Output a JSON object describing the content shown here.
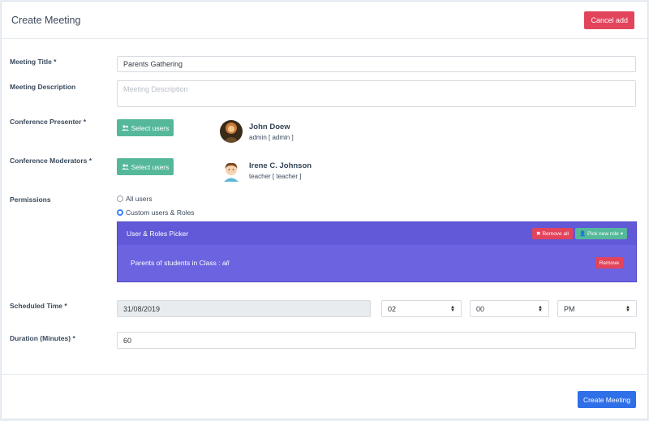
{
  "header": {
    "title": "Create Meeting",
    "cancel_label": "Cancel add"
  },
  "fields": {
    "title_label": "Meeting Title *",
    "title_value": "Parents Gathering",
    "description_label": "Meeting Description",
    "description_placeholder": "Meeting Description",
    "presenter_label": "Conference Presenter *",
    "moderators_label": "Conference Moderators *",
    "select_users_label": "Select users",
    "permissions_label": "Permissions",
    "scheduled_label": "Scheduled Time *",
    "duration_label": "Duration (Minutes) *",
    "duration_value": "60"
  },
  "presenter": {
    "name": "John Doew",
    "role": "admin [ admin ]"
  },
  "moderator": {
    "name": "Irene C. Johnson",
    "role": "teacher [ teacher ]"
  },
  "permissions": {
    "options": [
      "All users",
      "Custom users & Roles"
    ],
    "selected": "Custom users & Roles"
  },
  "picker": {
    "title": "User & Roles Picker",
    "remove_all_label": "Remove all",
    "pick_role_label": "Pick new role",
    "entry_text": "Parents of students in Class :",
    "entry_value": "all",
    "remove_label": "Remove"
  },
  "schedule": {
    "date": "31/08/2019",
    "hour": "02",
    "minute": "00",
    "ampm": "PM"
  },
  "footer": {
    "create_label": "Create Meeting"
  },
  "colors": {
    "accent": "#2f6fe8",
    "danger": "#e2445c",
    "success": "#55b89a",
    "picker": "#6b63e0"
  }
}
